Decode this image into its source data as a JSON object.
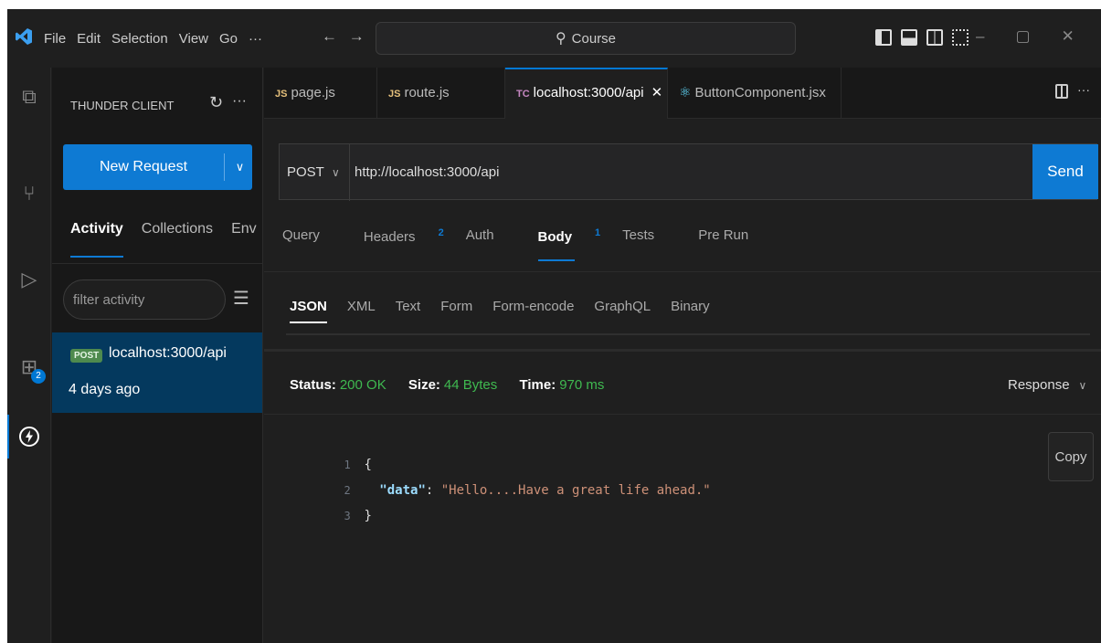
{
  "titlebar": {
    "menu": [
      "File",
      "Edit",
      "Selection",
      "View",
      "Go",
      "···"
    ],
    "back_arrow": "←",
    "forward_arrow": "→",
    "search_text": "Course",
    "window_controls": [
      "–",
      "▢",
      "✕"
    ]
  },
  "activitybar": {
    "items": [
      "explorer-icon",
      "source-control-icon",
      "run-debug-icon",
      "extensions-icon",
      "thunder-client-icon"
    ],
    "extensions_badge": "2"
  },
  "sidebar": {
    "title": "THUNDER CLIENT",
    "new_request_label": "New Request",
    "tabs": [
      "Activity",
      "Collections",
      "Env"
    ],
    "filter_placeholder": "filter activity",
    "activity_items": [
      {
        "method": "POST",
        "url": "localhost:3000/api",
        "time": "4 days ago"
      }
    ]
  },
  "editor_tabs": [
    {
      "icon": "JS",
      "label": "page.js"
    },
    {
      "icon": "JS",
      "label": "route.js"
    },
    {
      "icon": "TC",
      "label": "localhost:3000/api",
      "close": "✕"
    },
    {
      "icon": "react-icon",
      "label": "ButtonComponent.jsx"
    }
  ],
  "request": {
    "method": "POST",
    "url": "http://localhost:3000/api",
    "send_label": "Send",
    "tabs": [
      {
        "label": "Query"
      },
      {
        "label": "Headers",
        "count": "2"
      },
      {
        "label": "Auth"
      },
      {
        "label": "Body",
        "count": "1"
      },
      {
        "label": "Tests"
      },
      {
        "label": "Pre Run"
      }
    ],
    "body_tabs": [
      "JSON",
      "XML",
      "Text",
      "Form",
      "Form-encode",
      "GraphQL",
      "Binary"
    ]
  },
  "response": {
    "status_label": "Status:",
    "status_value": "200 OK",
    "size_label": "Size:",
    "size_value": "44 Bytes",
    "time_label": "Time:",
    "time_value": "970 ms",
    "view_select": "Response",
    "copy_label": "Copy",
    "lines": [
      {
        "num": "1",
        "text": "{"
      },
      {
        "num": "2",
        "key": "\"data\"",
        "sep": ": ",
        "value": "\"Hello....Have a great life ahead.\""
      },
      {
        "num": "3",
        "text": "}"
      }
    ]
  },
  "colors": {
    "accent": "#0e7ad3",
    "success": "#3fb950",
    "selection": "#04395e",
    "post_badge": "#4e8a4e"
  }
}
